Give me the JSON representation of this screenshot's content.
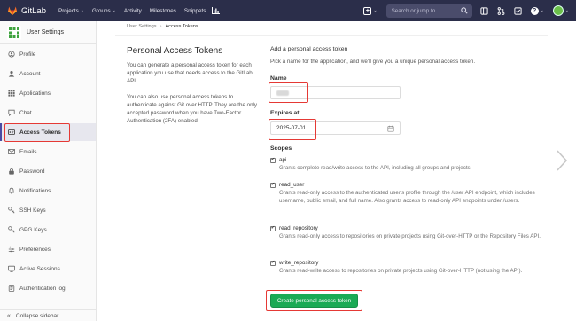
{
  "navbar": {
    "brand": "GitLab",
    "items": [
      {
        "label": "Projects",
        "caret": "⌄"
      },
      {
        "label": "Groups",
        "caret": "⌄"
      },
      {
        "label": "Activity",
        "caret": ""
      },
      {
        "label": "Milestones",
        "caret": ""
      },
      {
        "label": "Snippets",
        "caret": ""
      }
    ],
    "plus_icon": "plus-square-icon",
    "search_placeholder": "Search or jump to...",
    "help_label": "?",
    "caret": "⌄"
  },
  "sidebar": {
    "title": "User Settings",
    "items": [
      {
        "label": "Profile",
        "icon": "profile-icon"
      },
      {
        "label": "Account",
        "icon": "account-icon"
      },
      {
        "label": "Applications",
        "icon": "applications-icon"
      },
      {
        "label": "Chat",
        "icon": "chat-icon"
      },
      {
        "label": "Access Tokens",
        "icon": "access-tokens-icon",
        "active": true
      },
      {
        "label": "Emails",
        "icon": "emails-icon"
      },
      {
        "label": "Password",
        "icon": "password-icon"
      },
      {
        "label": "Notifications",
        "icon": "notifications-icon"
      },
      {
        "label": "SSH Keys",
        "icon": "ssh-keys-icon"
      },
      {
        "label": "GPG Keys",
        "icon": "gpg-keys-icon"
      },
      {
        "label": "Preferences",
        "icon": "preferences-icon"
      },
      {
        "label": "Active Sessions",
        "icon": "active-sessions-icon"
      },
      {
        "label": "Authentication log",
        "icon": "authentication-log-icon"
      }
    ],
    "collapse_label": "Collapse sidebar",
    "collapse_icon": "«"
  },
  "breadcrumb": {
    "parent": "User Settings",
    "separator": "›",
    "current": "Access Tokens"
  },
  "intro": {
    "title": "Personal Access Tokens",
    "paragraph1": "You can generate a personal access token for each application you use that needs access to the GitLab API.",
    "paragraph2": "You can also use personal access tokens to authenticate against Git over HTTP. They are the only accepted password when you have Two-Factor Authentication (2FA) enabled."
  },
  "form": {
    "title": "Add a personal access token",
    "description": "Pick a name for the application, and we'll give you a unique personal access token.",
    "name_label": "Name",
    "expires_label": "Expires at",
    "expires_value": "2025-07-01",
    "scopes_label": "Scopes",
    "scopes": [
      {
        "name": "api",
        "checked": true,
        "description": "Grants complete read/write access to the API, including all groups and projects."
      },
      {
        "name": "read_user",
        "checked": true,
        "description": "Grants read-only access to the authenticated user's profile through the /user API endpoint, which includes username, public email, and full name. Also grants access to read-only API endpoints under /users."
      },
      {
        "name": "read_repository",
        "checked": true,
        "description": "Grants read-only access to repositories on private projects using Git-over-HTTP or the Repository Files API."
      },
      {
        "name": "write_repository",
        "checked": true,
        "description": "Grants read-write access to repositories on private projects using Git-over-HTTP (not using the API)."
      }
    ],
    "check_mark": "✔",
    "submit_label": "Create personal access token"
  },
  "colors": {
    "navbar": "#2b2e4a",
    "accent": "#4b4ba3",
    "submit": "#1aaa55",
    "highlight": "#e53935"
  }
}
